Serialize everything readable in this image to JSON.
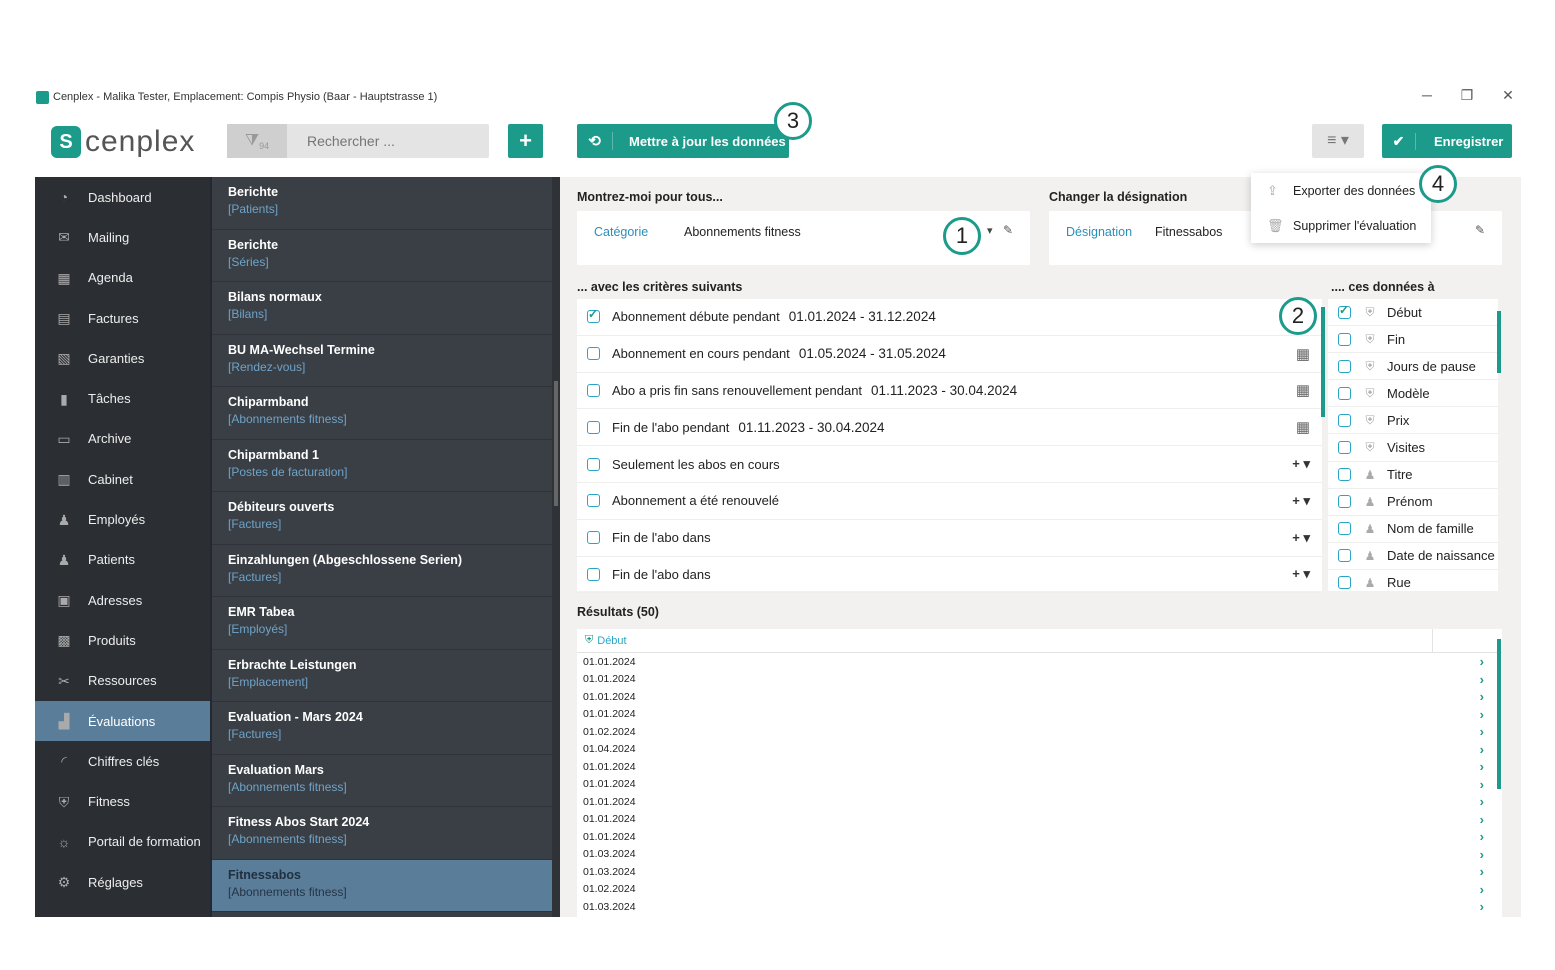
{
  "window": {
    "title": "Cenplex - Malika Tester, Emplacement: Compis Physio (Baar - Hauptstrasse 1)"
  },
  "toolbar": {
    "logo_text": "cenplex",
    "filter_count": "94",
    "search_placeholder": "Rechercher ...",
    "add_label": "+",
    "update_label": "Mettre à jour les données",
    "save_label": "Enregistrer"
  },
  "badges": [
    "1",
    "2",
    "3",
    "4"
  ],
  "menu": {
    "items": [
      {
        "label": "Exporter des données",
        "icon": "export-icon"
      },
      {
        "label": "Supprimer l'évaluation",
        "icon": "trash-icon"
      }
    ]
  },
  "sidebar": {
    "items": [
      {
        "label": "Dashboard",
        "icon": "dashboard-icon"
      },
      {
        "label": "Mailing",
        "icon": "mail-icon"
      },
      {
        "label": "Agenda",
        "icon": "calendar-icon"
      },
      {
        "label": "Factures",
        "icon": "calculator-icon"
      },
      {
        "label": "Garanties",
        "icon": "document-icon"
      },
      {
        "label": "Tâches",
        "icon": "clipboard-icon"
      },
      {
        "label": "Archive",
        "icon": "archive-icon"
      },
      {
        "label": "Cabinet",
        "icon": "building-icon"
      },
      {
        "label": "Employés",
        "icon": "employees-icon"
      },
      {
        "label": "Patients",
        "icon": "patients-icon"
      },
      {
        "label": "Adresses",
        "icon": "address-book-icon"
      },
      {
        "label": "Produits",
        "icon": "shop-icon"
      },
      {
        "label": "Ressources",
        "icon": "tools-icon"
      },
      {
        "label": "Évaluations",
        "icon": "chart-icon",
        "active": true
      },
      {
        "label": "Chiffres clés",
        "icon": "gauge-icon"
      },
      {
        "label": "Fitness",
        "icon": "fitness-icon"
      },
      {
        "label": "Portail de formation",
        "icon": "lightbulb-icon"
      },
      {
        "label": "Réglages",
        "icon": "gear-icon"
      }
    ]
  },
  "evaluations": [
    {
      "title": "Berichte",
      "type": "[Patients]"
    },
    {
      "title": "Berichte",
      "type": "[Séries]"
    },
    {
      "title": "Bilans normaux",
      "type": "[Bilans]"
    },
    {
      "title": "BU MA-Wechsel Termine",
      "type": "[Rendez-vous]"
    },
    {
      "title": "Chiparmband",
      "type": "[Abonnements fitness]"
    },
    {
      "title": "Chiparmband 1",
      "type": "[Postes de facturation]"
    },
    {
      "title": "Débiteurs ouverts",
      "type": "[Factures]"
    },
    {
      "title": "Einzahlungen (Abgeschlossene Serien)",
      "type": "[Factures]"
    },
    {
      "title": "EMR Tabea",
      "type": "[Employés]"
    },
    {
      "title": "Erbrachte Leistungen",
      "type": "[Emplacement]"
    },
    {
      "title": "Evaluation - Mars 2024",
      "type": "[Factures]"
    },
    {
      "title": "Evaluation Mars",
      "type": "[Abonnements fitness]"
    },
    {
      "title": "Fitness Abos Start 2024",
      "type": "[Abonnements fitness]"
    },
    {
      "title": "Fitnessabos",
      "type": "[Abonnements fitness]",
      "active": true
    }
  ],
  "show_for": {
    "title": "Montrez-moi pour tous...",
    "category_label": "Catégorie",
    "category_value": "Abonnements fitness"
  },
  "designation": {
    "title": "Changer la désignation",
    "label": "Désignation",
    "value": "Fitnessabos"
  },
  "criteria": {
    "title": "... avec les critères suivants",
    "rows": [
      {
        "label": "Abonnement débute pendant",
        "value": "01.01.2024 - 31.12.2024",
        "checked": true,
        "action": ""
      },
      {
        "label": "Abonnement en cours pendant",
        "value": "01.05.2024 - 31.05.2024",
        "checked": false,
        "action": "calendar"
      },
      {
        "label": "Abo a pris fin sans renouvellement pendant",
        "value": "01.11.2023 - 30.04.2024",
        "checked": false,
        "action": "calendar"
      },
      {
        "label": "Fin de l'abo pendant",
        "value": "01.11.2023 - 30.04.2024",
        "checked": false,
        "action": "calendar"
      },
      {
        "label": "Seulement les abos en cours",
        "value": "",
        "checked": false,
        "action": "plus"
      },
      {
        "label": "Abonnement a été renouvelé",
        "value": "",
        "checked": false,
        "action": "plus"
      },
      {
        "label": "Fin de l'abo dans",
        "value": "",
        "checked": false,
        "action": "plus"
      },
      {
        "label": "Fin de l'abo dans",
        "value": "",
        "checked": false,
        "action": "plus"
      }
    ]
  },
  "data_fields": {
    "title": ".... ces données à",
    "rows": [
      {
        "label": "Début",
        "checked": true,
        "icon": "fitness-icon"
      },
      {
        "label": "Fin",
        "checked": false,
        "icon": "fitness-icon"
      },
      {
        "label": "Jours de pause",
        "checked": false,
        "icon": "fitness-icon"
      },
      {
        "label": "Modèle",
        "checked": false,
        "icon": "fitness-icon"
      },
      {
        "label": "Prix",
        "checked": false,
        "icon": "fitness-icon"
      },
      {
        "label": "Visites",
        "checked": false,
        "icon": "fitness-icon"
      },
      {
        "label": "Titre",
        "checked": false,
        "icon": "patients-icon"
      },
      {
        "label": "Prénom",
        "checked": false,
        "icon": "patients-icon"
      },
      {
        "label": "Nom de famille",
        "checked": false,
        "icon": "patients-icon"
      },
      {
        "label": "Date de naissance",
        "checked": false,
        "icon": "patients-icon"
      },
      {
        "label": "Rue",
        "checked": false,
        "icon": "patients-icon"
      }
    ]
  },
  "results": {
    "title": "Résultats (50)",
    "column": "Début",
    "rows": [
      "01.01.2024",
      "01.01.2024",
      "01.01.2024",
      "01.01.2024",
      "01.02.2024",
      "01.04.2024",
      "01.01.2024",
      "01.01.2024",
      "01.01.2024",
      "01.01.2024",
      "01.01.2024",
      "01.03.2024",
      "01.03.2024",
      "01.02.2024",
      "01.03.2024"
    ]
  },
  "colors": {
    "accent": "#1c9a8a",
    "sidebar_bg": "#2b2e33",
    "active_bg": "#5a7d9a",
    "link": "#2a8fb9"
  }
}
